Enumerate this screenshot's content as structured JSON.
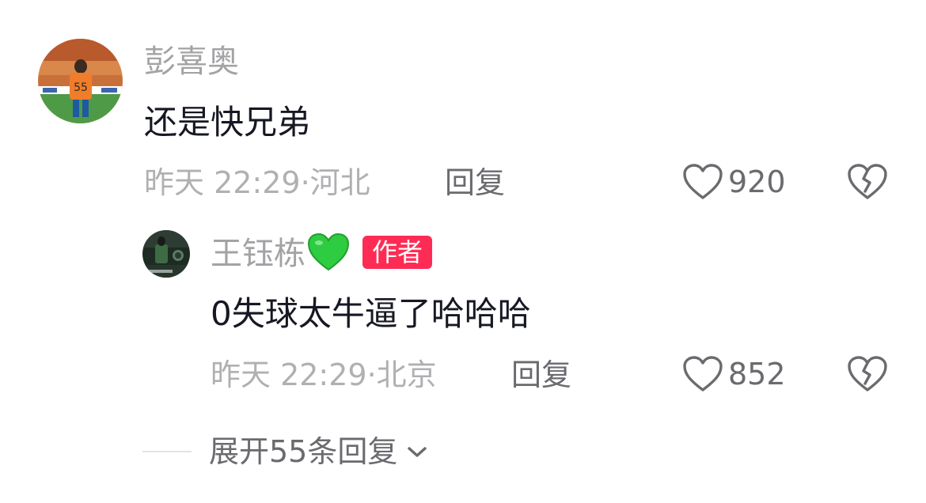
{
  "comment": {
    "username": "彭喜奥",
    "text": "还是快兄弟",
    "time": "昨天 22:29·",
    "location": "河北",
    "reply_label": "回复",
    "likes": "920",
    "avatar_jersey_number": "55"
  },
  "reply": {
    "username": "王钰栋",
    "emoji": "💚",
    "author_badge": "作者",
    "text": "0失球太牛逼了哈哈哈",
    "time": "昨天 22:29·",
    "location": "北京",
    "reply_label": "回复",
    "likes": "852"
  },
  "expand": {
    "label": "展开55条回复"
  },
  "colors": {
    "accent": "#fe2c55",
    "text_primary": "#161823",
    "text_secondary": "#a3a3a6",
    "emoji_green": "#2ecc40"
  }
}
